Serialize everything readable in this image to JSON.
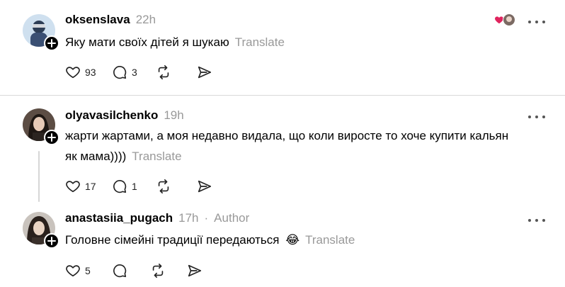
{
  "posts": [
    {
      "username": "oksenslava",
      "time": "22h",
      "text": "Яку мати своїх дітей я шукаю",
      "translate": "Translate",
      "likes": "93",
      "replies": "3",
      "icons": [
        "heart-icon",
        "comment-icon",
        "repost-icon",
        "share-icon"
      ]
    },
    {
      "username": "olyavasilchenko",
      "time": "19h",
      "text": "жарти жартами, а моя недавно видала, що коли виросте то хоче купити кальян як мама))))",
      "translate": "Translate",
      "likes": "17",
      "replies": "1"
    },
    {
      "username": "anastasiia_pugach",
      "time": "17h",
      "author_label": "Author",
      "text": "Головне сімейні традиції передаються",
      "emoji": "😂",
      "translate": "Translate",
      "likes": "5",
      "replies": ""
    }
  ],
  "colors": {
    "muted": "#999999",
    "liked_heart": "#e0245e",
    "divider": "#d9d9d9"
  }
}
